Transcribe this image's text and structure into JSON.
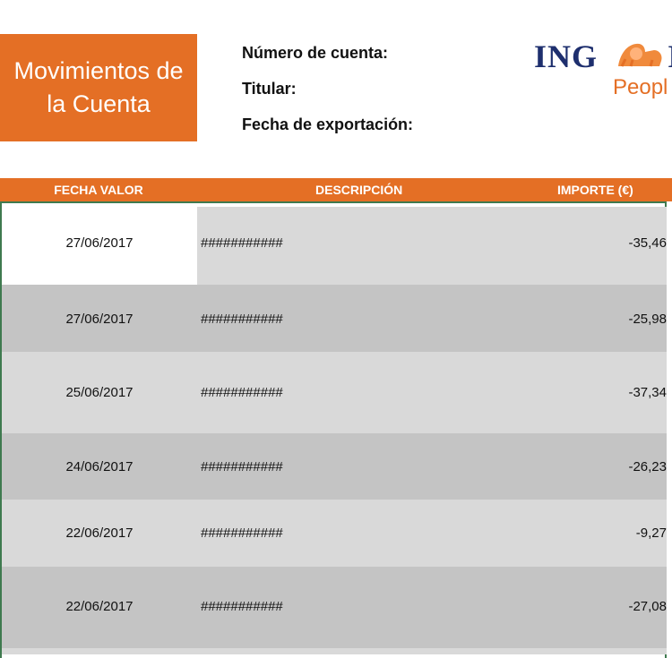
{
  "header": {
    "title_line1": "Movimientos de",
    "title_line2": "la Cuenta",
    "account_label": "Número de cuenta:",
    "holder_label": "Titular:",
    "export_date_label": "Fecha de exportación:"
  },
  "logo": {
    "text": "ING",
    "tagline": "Peopl"
  },
  "colors": {
    "accent": "#E46F25",
    "frame": "#3F7A4F",
    "row_light": "#D9D9D9",
    "row_dark": "#C4C4C4"
  },
  "table": {
    "columns": [
      "FECHA VALOR",
      "DESCRIPCIÓN",
      "IMPORTE (€)"
    ],
    "rows": [
      {
        "date": "27/06/2017",
        "desc": "###########",
        "amount": "-35,46"
      },
      {
        "date": "27/06/2017",
        "desc": "###########",
        "amount": "-25,98"
      },
      {
        "date": "25/06/2017",
        "desc": "###########",
        "amount": "-37,34"
      },
      {
        "date": "24/06/2017",
        "desc": "###########",
        "amount": "-26,23"
      },
      {
        "date": "22/06/2017",
        "desc": "###########",
        "amount": "-9,27"
      },
      {
        "date": "22/06/2017",
        "desc": "###########",
        "amount": "-27,08"
      }
    ]
  }
}
